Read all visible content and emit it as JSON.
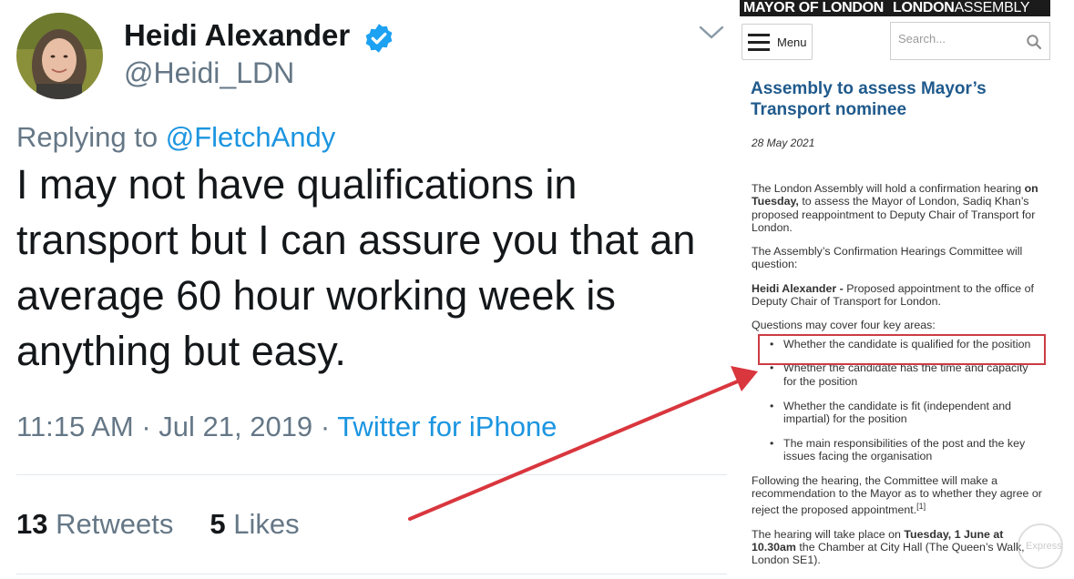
{
  "tweet": {
    "display_name": "Heidi Alexander",
    "handle": "@Heidi_LDN",
    "reply_prefix": "Replying to",
    "reply_to": "@FletchAndy",
    "text": "I may not have qualifications in transport but I can assure you that an average 60 hour working week is anything but easy.",
    "time": "11:15 AM",
    "date": "Jul 21, 2019",
    "separator": "·",
    "source": "Twitter for iPhone",
    "retweets_count": "13",
    "retweets_label": "Retweets",
    "likes_count": "5",
    "likes_label": "Likes",
    "icons": {
      "verified": "verified-badge-icon",
      "chevron": "chevron-down-icon"
    },
    "colors": {
      "link": "#1b95e0",
      "muted": "#657786",
      "text": "#14171a",
      "verified": "#1da1f2"
    }
  },
  "assembly": {
    "banner_mayor": "MAYOR OF LONDON",
    "banner_london": "LONDON",
    "banner_assembly": "ASSEMBLY",
    "menu_label": "Menu",
    "search_placeholder": "Search...",
    "title": "Assembly to assess Mayor’s Transport nominee",
    "date": "28 May 2021",
    "p1_a": "The London Assembly will hold a confirmation hearing ",
    "p1_bold": "on Tuesday,",
    "p1_b": " to assess the Mayor of London, Sadiq Khan’s proposed reappointment to Deputy Chair of Transport for London.",
    "p2": "The Assembly’s Confirmation Hearings Committee will question:",
    "p3_bold": "Heidi Alexander -",
    "p3": " Proposed appointment to the office of Deputy Chair of Transport for London.",
    "p4": "Questions may cover four key areas:",
    "areas": [
      "Whether the candidate is qualified for the position",
      "Whether the candidate has the time and capacity for the position",
      "Whether the candidate is fit (independent and impartial) for the position",
      "The main responsibilities of the post and the key issues facing the organisation"
    ],
    "p5": "Following the hearing, the Committee will make a recommendation to the Mayor as to whether they agree or reject the proposed appointment.",
    "p5_sup": "[1]",
    "p6_a": "The hearing will take place on ",
    "p6_bold": "Tuesday, 1 June at 10.30am",
    "p6_b": " the Chamber at City Hall (The Queen’s Walk, London SE1).",
    "watermark": "Express",
    "icons": {
      "menu": "hamburger-menu-icon",
      "search": "search-icon"
    },
    "colors": {
      "title": "#1f5a8c",
      "highlight": "#cc3c44",
      "banner": "#1b1b1b"
    }
  },
  "annotation": {
    "arrow_color": "#d9363e"
  }
}
